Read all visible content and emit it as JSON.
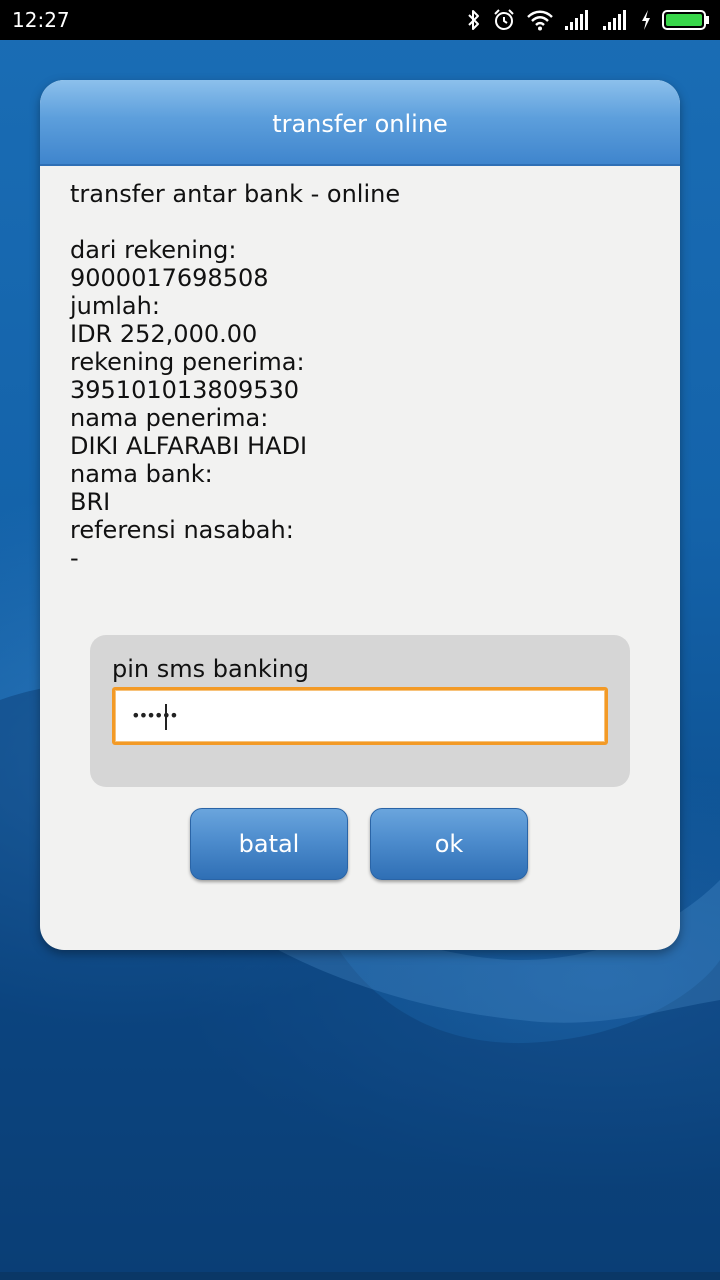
{
  "status_bar": {
    "time": "12:27",
    "icons": [
      "bluetooth-icon",
      "alarm-icon",
      "wifi-icon",
      "signal-icon",
      "signal-icon",
      "charging-icon",
      "battery-icon"
    ]
  },
  "dialog": {
    "title": "transfer online",
    "heading": "transfer antar bank - online",
    "fields": [
      {
        "label": "dari rekening:",
        "value": "9000017698508"
      },
      {
        "label": "jumlah:",
        "value": "IDR 252,000.00"
      },
      {
        "label": "rekening penerima:",
        "value": "395101013809530"
      },
      {
        "label": "nama penerima:",
        "value": "DIKI ALFARABI HADI"
      },
      {
        "label": "nama bank:",
        "value": "BRI"
      },
      {
        "label": "referensi nasabah:",
        "value": "-"
      }
    ],
    "pin": {
      "label": "pin sms banking",
      "value": "••••••"
    },
    "buttons": {
      "cancel": "batal",
      "ok": "ok"
    }
  },
  "colors": {
    "header_blue": "#4a8fd3",
    "button_blue": "#3f7ec3",
    "input_focus": "#f39a26",
    "dialog_bg": "#f2f2f1"
  }
}
